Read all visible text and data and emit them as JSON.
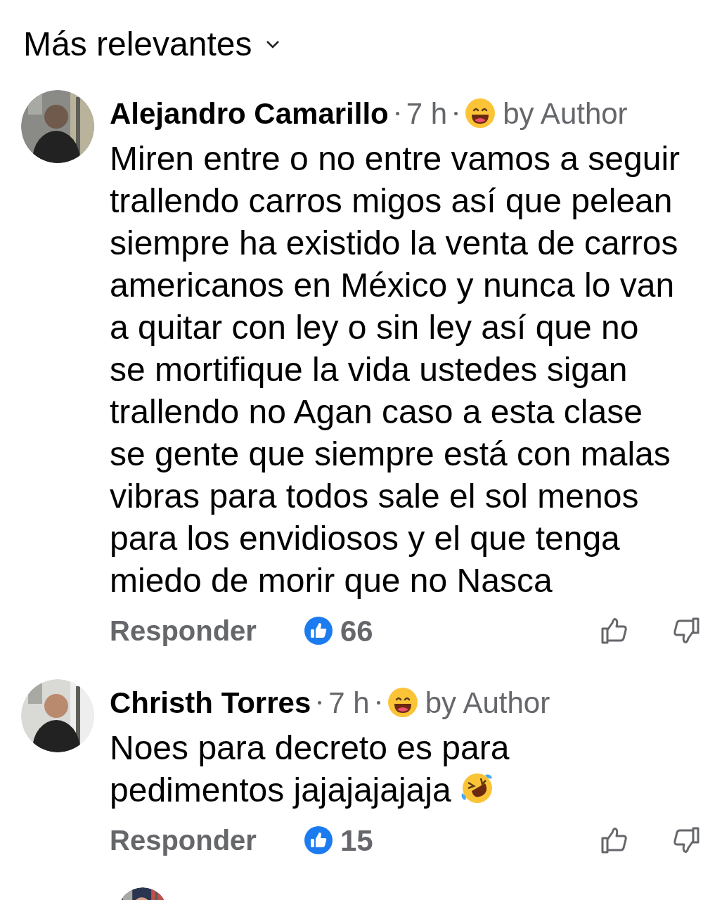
{
  "sort": {
    "label": "Más relevantes"
  },
  "comments": [
    {
      "author": "Alejandro Camarillo",
      "time": "7 h",
      "badge": "by Author",
      "text": "Miren entre o no entre vamos a seguir trallendo carros migos así que pelean siempre ha existido la venta de carros americanos en México y nunca lo van a quitar con ley o sin ley así que no se mortifique la vida ustedes sigan trallendo no Agan caso a esta clase se gente que siempre está con malas vibras para todos sale el sol menos para los envidiosos y el que tenga miedo de morir que no Nasca",
      "ends_with_icon": false,
      "reply": "Responder",
      "likes": "66"
    },
    {
      "author": "Christh Torres",
      "time": "7 h",
      "badge": "by Author",
      "text": "Noes para decreto es para pedimentos jajajajajaja",
      "ends_with_icon": true,
      "reply": "Responder",
      "likes": "15"
    }
  ]
}
